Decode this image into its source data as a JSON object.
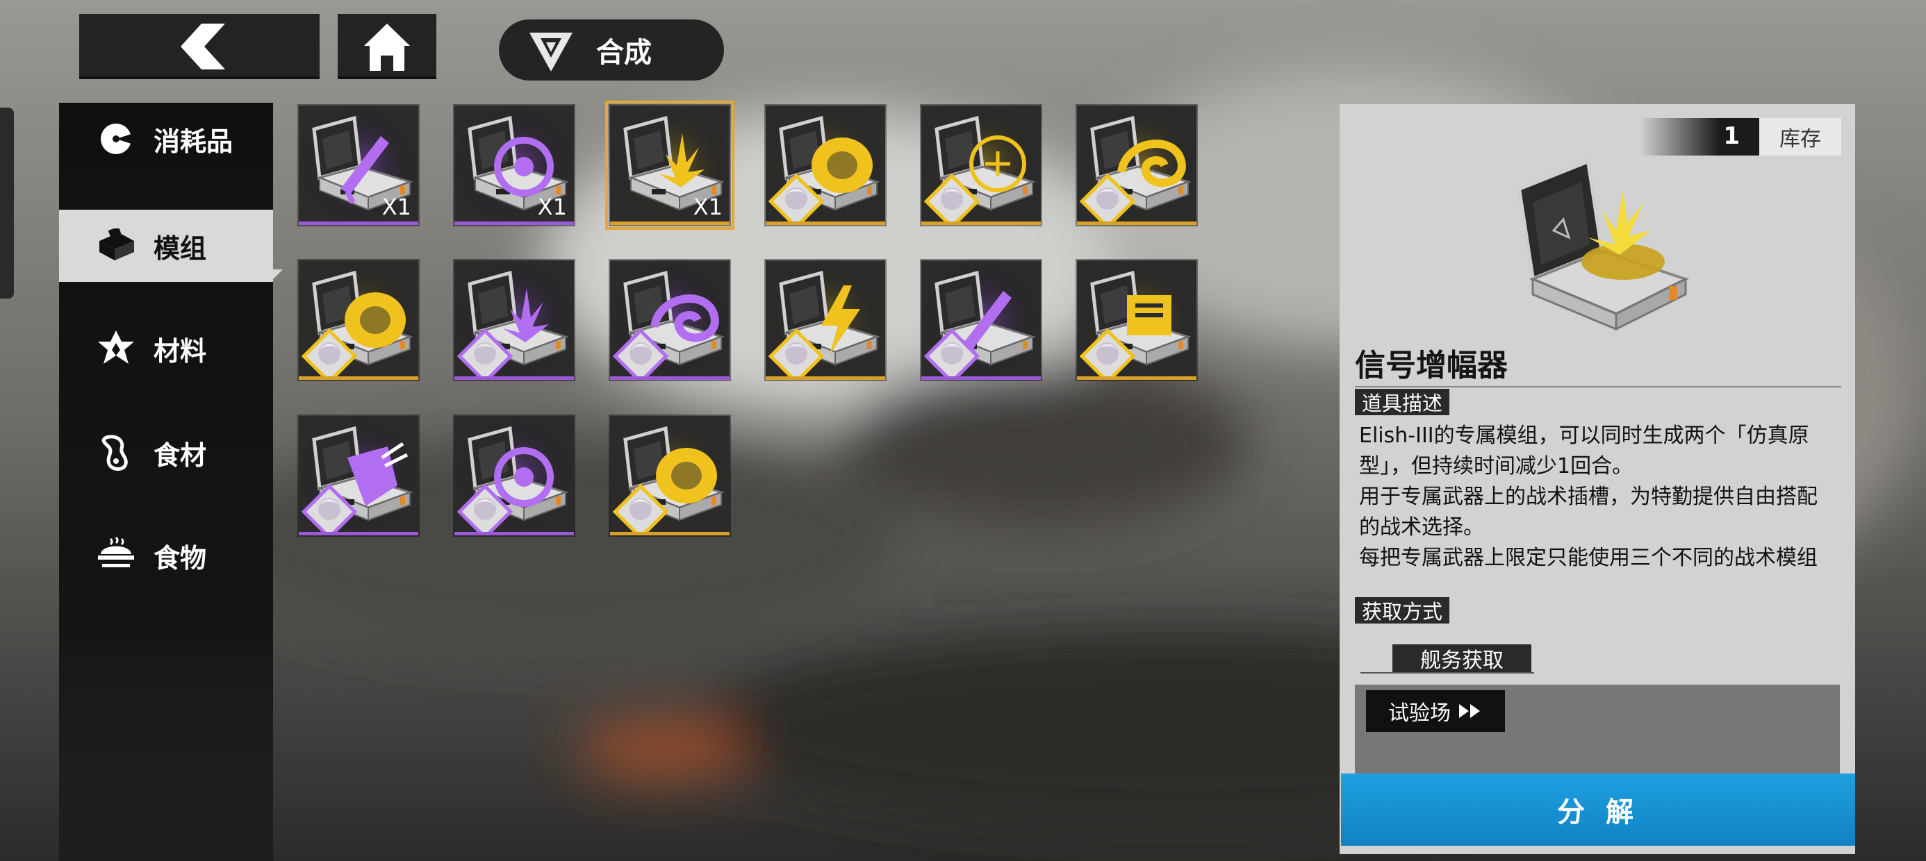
{
  "header": {
    "back_icon": "chevron-left-icon",
    "home_icon": "home-icon",
    "mode_icon": "faction-emblem-icon",
    "mode_label": "合成"
  },
  "sidebar": {
    "items": [
      {
        "label": "消耗品",
        "icon": "pie-chart-icon",
        "active": false
      },
      {
        "label": "模组",
        "icon": "box-icon",
        "active": true
      },
      {
        "label": "材料",
        "icon": "star-icon",
        "active": false
      },
      {
        "label": "食材",
        "icon": "ingredient-icon",
        "active": false
      },
      {
        "label": "食物",
        "icon": "roast-chicken-icon",
        "active": false
      }
    ]
  },
  "grid": {
    "items": [
      {
        "rarity": "purple",
        "glyph": "blade",
        "qty": "X1",
        "avatar": false,
        "selected": false
      },
      {
        "rarity": "purple",
        "glyph": "ring",
        "qty": "X1",
        "avatar": false,
        "selected": false
      },
      {
        "rarity": "gold",
        "glyph": "spark",
        "qty": "X1",
        "avatar": false,
        "selected": true
      },
      {
        "rarity": "gold",
        "glyph": "disc",
        "qty": "",
        "avatar": true,
        "selected": false
      },
      {
        "rarity": "gold",
        "glyph": "circle",
        "qty": "",
        "avatar": true,
        "selected": false
      },
      {
        "rarity": "gold",
        "glyph": "swirl",
        "qty": "",
        "avatar": true,
        "selected": false
      },
      {
        "rarity": "gold",
        "glyph": "disc",
        "qty": "",
        "avatar": true,
        "selected": false
      },
      {
        "rarity": "purple",
        "glyph": "spark",
        "qty": "",
        "avatar": true,
        "selected": false
      },
      {
        "rarity": "purple",
        "glyph": "swirl",
        "qty": "",
        "avatar": true,
        "selected": false
      },
      {
        "rarity": "gold",
        "glyph": "bolt",
        "qty": "",
        "avatar": true,
        "selected": false
      },
      {
        "rarity": "purple",
        "glyph": "blade",
        "qty": "",
        "avatar": true,
        "selected": false
      },
      {
        "rarity": "gold",
        "glyph": "box",
        "qty": "",
        "avatar": true,
        "selected": false
      },
      {
        "rarity": "purple",
        "glyph": "shield",
        "qty": "",
        "avatar": true,
        "selected": false
      },
      {
        "rarity": "purple",
        "glyph": "ring",
        "qty": "",
        "avatar": true,
        "selected": false
      },
      {
        "rarity": "gold",
        "glyph": "disc",
        "qty": "",
        "avatar": true,
        "selected": false
      }
    ]
  },
  "detail": {
    "stock_count": "1",
    "stock_label": "库存",
    "item_name": "信号增幅器",
    "desc_label": "道具描述",
    "description": [
      "Elish-III的专属模组，可以同时生成两个「仿真原型」，但持续时间减少1回合。",
      "用于专属武器上的战术插槽，为特勤提供自由搭配的战术选择。",
      "每把专属武器上限定只能使用三个不同的战术模组"
    ],
    "source_label": "获取方式",
    "source_tab": "舰务获取",
    "trial_button": "试验场",
    "trial_icon": "fast-forward-icon",
    "decompose_button": "分 解"
  },
  "colors": {
    "purple_rarity": "#9a5ad8",
    "gold_rarity": "#d9a227",
    "accent_blue": "#1a95d8",
    "selected_outline": "#e0a93a"
  }
}
